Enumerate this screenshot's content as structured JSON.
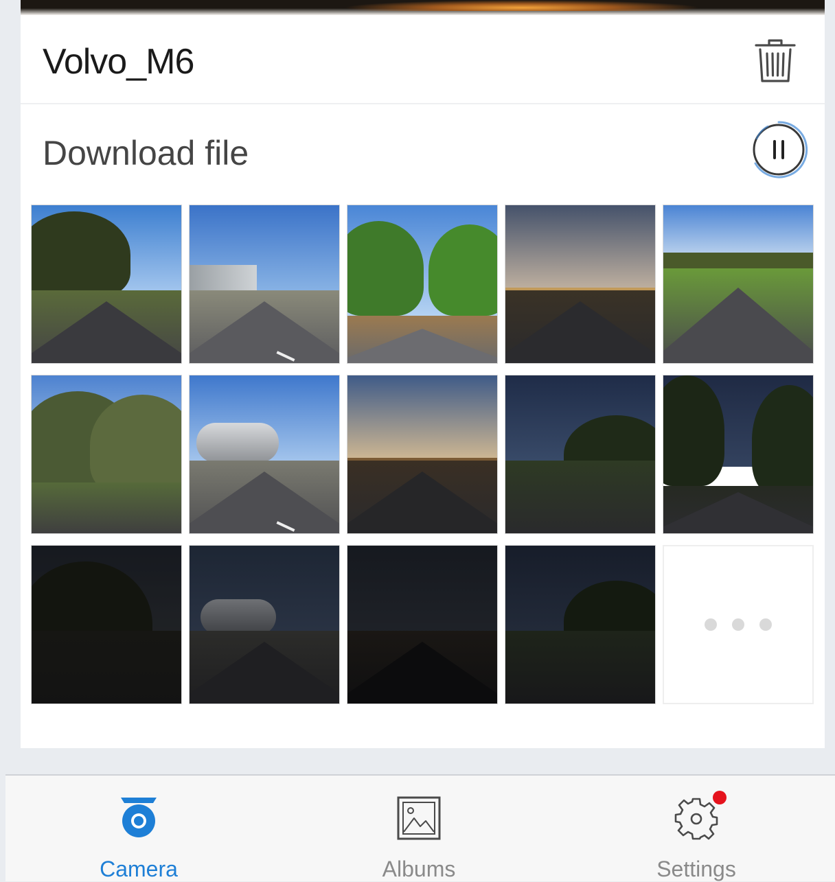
{
  "device": {
    "name": "Volvo_M6",
    "delete_icon": "trash-icon"
  },
  "download": {
    "label": "Download file",
    "control_icon": "pause-icon"
  },
  "thumbnails": [
    {
      "scene": "cypress-road-clouds"
    },
    {
      "scene": "highway-noise-wall"
    },
    {
      "scene": "tree-lined-road"
    },
    {
      "scene": "highway-dusk"
    },
    {
      "scene": "country-road-green"
    },
    {
      "scene": "gum-tree-road"
    },
    {
      "scene": "tanker-truck-highway"
    },
    {
      "scene": "highway-sunset"
    },
    {
      "scene": "suburb-street-dusk"
    },
    {
      "scene": "dark-trees-road"
    },
    {
      "scene": "dark-forest"
    },
    {
      "scene": "tanker-truck-dark"
    },
    {
      "scene": "highway-night"
    },
    {
      "scene": "suburb-street-night"
    }
  ],
  "more_tile": {
    "icon": "more-dots-icon"
  },
  "tabs": [
    {
      "label": "Camera",
      "icon": "camera-icon",
      "active": true
    },
    {
      "label": "Albums",
      "icon": "albums-icon",
      "active": false
    },
    {
      "label": "Settings",
      "icon": "gear-icon",
      "active": false,
      "has_badge": true
    }
  ],
  "colors": {
    "accent": "#1e7fd6",
    "badge": "#e5131d",
    "inactive": "#8a8a8a"
  }
}
